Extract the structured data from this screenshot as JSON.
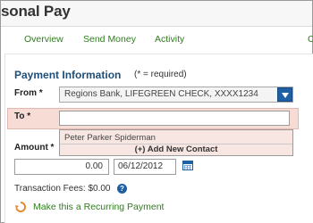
{
  "header": {
    "title": "sonal Pay"
  },
  "nav": {
    "items": [
      {
        "label": "Overview"
      },
      {
        "label": "Send Money"
      },
      {
        "label": "Activity"
      },
      {
        "label": "C"
      }
    ]
  },
  "payment": {
    "section_title": "Payment Information",
    "required_note": "(* = required)",
    "from_label": "From *",
    "from_value": "Regions Bank, LIFEGREEN CHECK, XXXX1234",
    "to_label": "To *",
    "to_value": "",
    "suggestions": [
      "Peter Parker Spiderman"
    ],
    "add_contact_label": "(+) Add New Contact",
    "amount_label": "Amount *",
    "amount_value": "0.00",
    "date_value": "06/12/2012",
    "fees_text": "Transaction Fees: $0.00",
    "recurring_link": "Make this a Recurring Payment"
  },
  "colors": {
    "link_green": "#2f7d1e",
    "section_blue": "#1f4e7a",
    "to_row_highlight": "#f7dcd6",
    "accent_blue": "#1f5fa3"
  },
  "icons": {
    "select_arrow": "chevron-down-icon",
    "calendar": "calendar-icon",
    "help": "help-icon",
    "recurring": "refresh-icon"
  }
}
